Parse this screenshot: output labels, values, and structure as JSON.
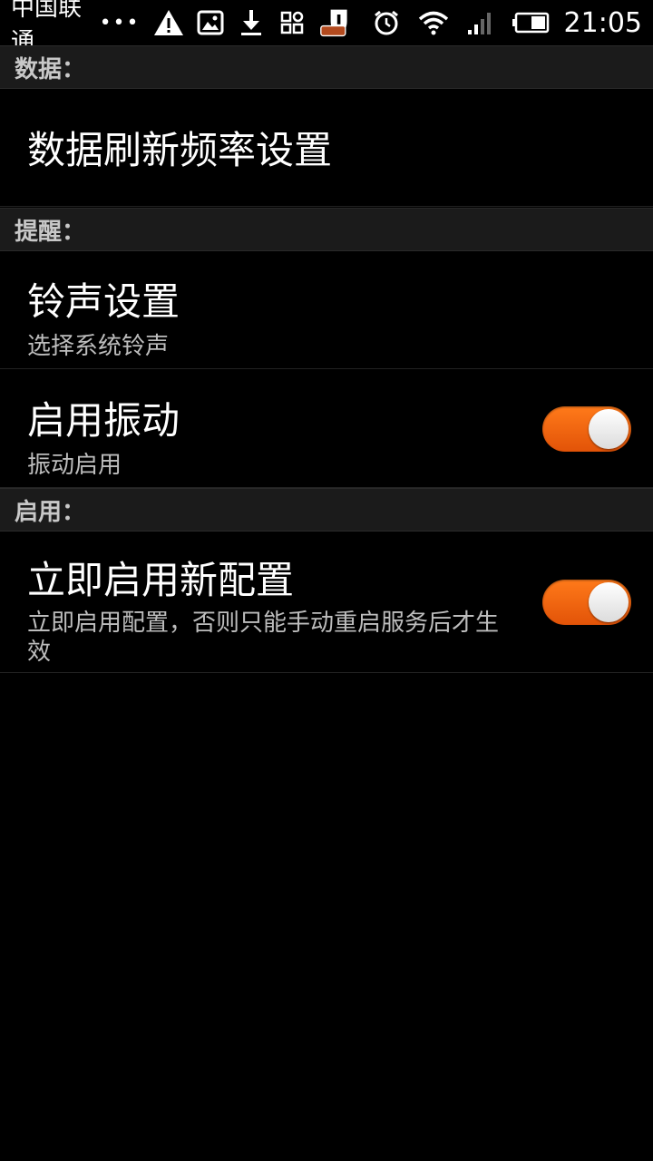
{
  "status_bar": {
    "carrier": "中国联通",
    "dots": "•••",
    "time": "21:05",
    "icons_left": [
      "warning-icon",
      "image-icon",
      "download-icon",
      "grid-icon",
      "security-icon"
    ],
    "icons_right": [
      "alarm-icon",
      "wifi-icon",
      "signal-icon",
      "battery-icon"
    ]
  },
  "sections": {
    "data": {
      "header": "数据：",
      "items": [
        {
          "title": "数据刷新频率设置"
        }
      ]
    },
    "reminder": {
      "header": "提醒：",
      "items": [
        {
          "title": "铃声设置",
          "summary": "选择系统铃声"
        },
        {
          "title": "启用振动",
          "summary": "振动启用",
          "toggle_on": true
        }
      ]
    },
    "enable": {
      "header": "启用：",
      "items": [
        {
          "title": "立即启用新配置",
          "summary": "立即启用配置，否则只能手动重启服务后才生效",
          "toggle_on": true
        }
      ]
    }
  },
  "colors": {
    "toggle_accent": "#f26a0e",
    "header_bg": "#1b1b1b",
    "background": "#000000"
  }
}
